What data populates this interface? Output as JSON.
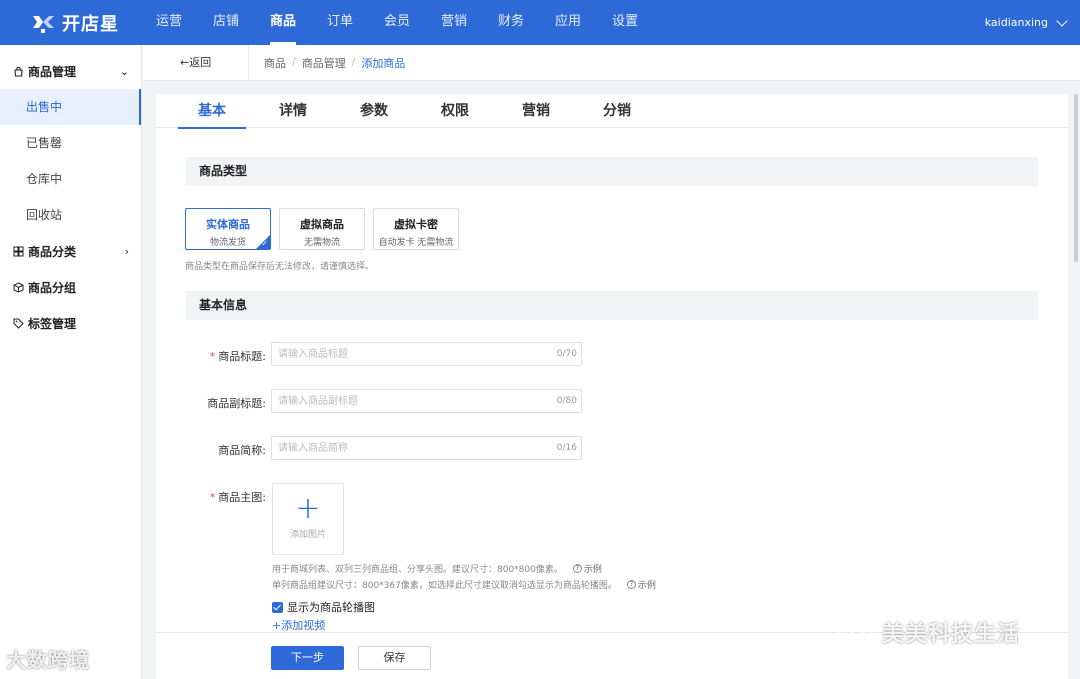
{
  "brand": {
    "name": "开店星",
    "color": "#2d6ad8"
  },
  "topnav": {
    "items": [
      {
        "label": "运营"
      },
      {
        "label": "店铺"
      },
      {
        "label": "商品",
        "active": true
      },
      {
        "label": "订单"
      },
      {
        "label": "会员"
      },
      {
        "label": "营销"
      },
      {
        "label": "财务"
      },
      {
        "label": "应用"
      },
      {
        "label": "设置"
      }
    ],
    "user": "kaidianxing"
  },
  "sidebar": {
    "group_product_mgmt": "商品管理",
    "items": [
      {
        "label": "出售中",
        "active": true
      },
      {
        "label": "已售罄"
      },
      {
        "label": "仓库中"
      },
      {
        "label": "回收站"
      }
    ],
    "group_category": "商品分类",
    "group_grouping": "商品分组",
    "group_tags": "标签管理"
  },
  "breadcrumb": {
    "back": "←返回",
    "items": [
      "商品",
      "商品管理",
      "添加商品"
    ]
  },
  "tabs": [
    "基本",
    "详情",
    "参数",
    "权限",
    "营销",
    "分销"
  ],
  "sections": {
    "type_title": "商品类型",
    "basic_title": "基本信息"
  },
  "product_types": [
    {
      "title": "实体商品",
      "desc": "物流发货",
      "selected": true
    },
    {
      "title": "虚拟商品",
      "desc": "无需物流"
    },
    {
      "title": "虚拟卡密",
      "desc": "自动发卡 无需物流"
    }
  ],
  "type_hint": "商品类型在商品保存后无法修改，请谨慎选择。",
  "fields": {
    "title": {
      "label": "商品标题:",
      "placeholder": "请输入商品标题",
      "count": "0/70",
      "required": true
    },
    "subtitle": {
      "label": "商品副标题:",
      "placeholder": "请输入商品副标题",
      "count": "0/80"
    },
    "short": {
      "label": "商品简称:",
      "placeholder": "请输入商品简称",
      "count": "0/16"
    },
    "main_image": {
      "label": "商品主图:",
      "required": true,
      "upload_text": "添加图片"
    }
  },
  "image_help": {
    "line1": "用于商城列表、双列三列商品组、分享头图。建议尺寸：800*800像素。",
    "line2": "单列商品组建议尺寸：800*367像素，如选择此尺寸建议取消勾选显示为商品轮播图。",
    "example": "示例"
  },
  "carousel_checkbox": {
    "label": "显示为商品轮播图",
    "checked": true
  },
  "add_video": "+添加视频",
  "footer": {
    "next": "下一步",
    "save": "保存"
  },
  "watermarks": {
    "left": "大数跨境",
    "right": "美美科技生活"
  }
}
